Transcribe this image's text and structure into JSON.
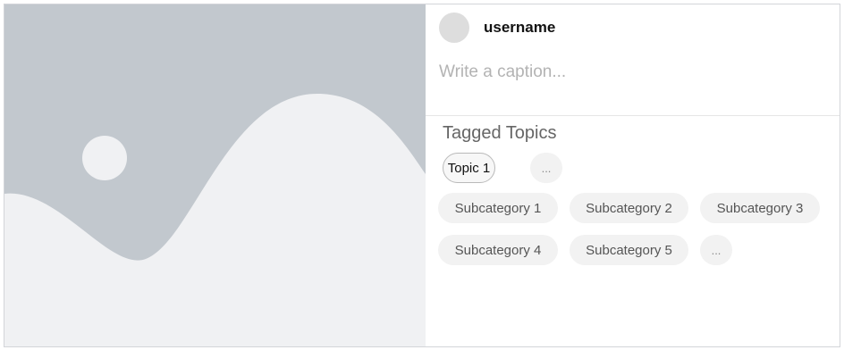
{
  "post": {
    "username": "username",
    "caption_placeholder": "Write a caption...",
    "caption_value": ""
  },
  "tags": {
    "section_title": "Tagged Topics",
    "topics": [
      "Topic 1"
    ],
    "topics_more": "...",
    "subcategories": [
      "Subcategory 1",
      "Subcategory 2",
      "Subcategory 3",
      "Subcategory 4",
      "Subcategory 5"
    ],
    "subcategories_more": "..."
  },
  "colors": {
    "image_placeholder_bg": "#c2c8ce",
    "image_placeholder_fg": "#f0f1f3",
    "chip_bg": "#f2f2f2",
    "chip_selected_border": "#b9b9b9"
  },
  "icons": {
    "media": "image-placeholder-icon"
  }
}
